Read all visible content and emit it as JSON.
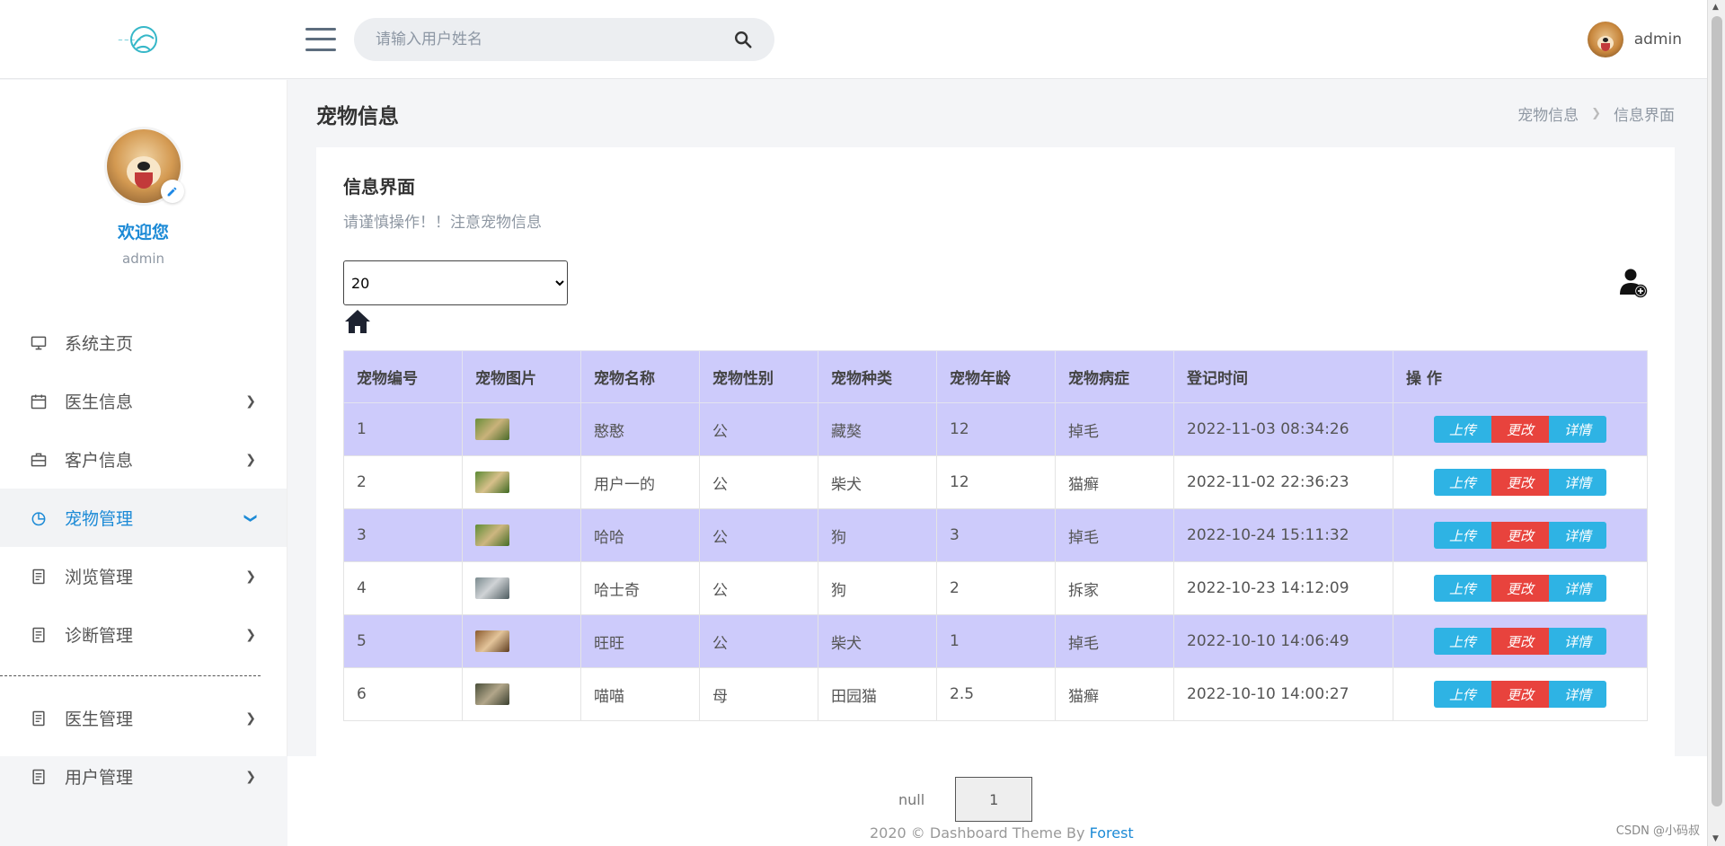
{
  "header": {
    "search_placeholder": "请输入用户姓名",
    "user_name": "admin"
  },
  "sidebar": {
    "welcome": "欢迎您",
    "user_name": "admin",
    "items": [
      {
        "label": "系统主页",
        "icon": "monitor-icon",
        "chevron": false,
        "active": false
      },
      {
        "label": "医生信息",
        "icon": "calendar-icon",
        "chevron": true,
        "active": false
      },
      {
        "label": "客户信息",
        "icon": "briefcase-icon",
        "chevron": true,
        "active": false
      },
      {
        "label": "宠物管理",
        "icon": "pie-chart-icon",
        "chevron": true,
        "active": true
      },
      {
        "label": "浏览管理",
        "icon": "document-icon",
        "chevron": true,
        "active": false
      },
      {
        "label": "诊断管理",
        "icon": "document-icon",
        "chevron": true,
        "active": false
      },
      {
        "label": "医生管理",
        "icon": "document-icon",
        "chevron": true,
        "active": false
      },
      {
        "label": "用户管理",
        "icon": "document-icon",
        "chevron": true,
        "active": false
      }
    ]
  },
  "page": {
    "title": "宠物信息",
    "breadcrumb": [
      "宠物信息",
      "信息界面"
    ]
  },
  "card": {
    "title": "信息界面",
    "subtitle": "请谨慎操作！！注意宠物信息",
    "page_size": "20"
  },
  "table": {
    "headers": [
      "宠物编号",
      "宠物图片",
      "宠物名称",
      "宠物性别",
      "宠物种类",
      "宠物年龄",
      "宠物病症",
      "登记时间",
      "操 作"
    ],
    "rows": [
      {
        "id": "1",
        "name": "憨憨",
        "sex": "公",
        "kind": "藏獒",
        "age": "12",
        "disease": "掉毛",
        "time": "2022-11-03 08:34:26"
      },
      {
        "id": "2",
        "name": "用户一的",
        "sex": "公",
        "kind": "柴犬",
        "age": "12",
        "disease": "猫癣",
        "time": "2022-11-02 22:36:23"
      },
      {
        "id": "3",
        "name": "哈哈",
        "sex": "公",
        "kind": "狗",
        "age": "3",
        "disease": "掉毛",
        "time": "2022-10-24 15:11:32"
      },
      {
        "id": "4",
        "name": "哈士奇",
        "sex": "公",
        "kind": "狗",
        "age": "2",
        "disease": "拆家",
        "time": "2022-10-23 14:12:09"
      },
      {
        "id": "5",
        "name": "旺旺",
        "sex": "公",
        "kind": "柴犬",
        "age": "1",
        "disease": "掉毛",
        "time": "2022-10-10 14:06:49"
      },
      {
        "id": "6",
        "name": "喵喵",
        "sex": "母",
        "kind": "田园猫",
        "age": "2.5",
        "disease": "猫癣",
        "time": "2022-10-10 14:00:27"
      }
    ],
    "actions": {
      "upload": "上传",
      "edit": "更改",
      "detail": "详情"
    }
  },
  "pager": {
    "prev": "null",
    "current": "1"
  },
  "footer": {
    "text": "2020 © Dashboard Theme By ",
    "link": "Forest"
  },
  "watermark": "CSDN @小码叔"
}
